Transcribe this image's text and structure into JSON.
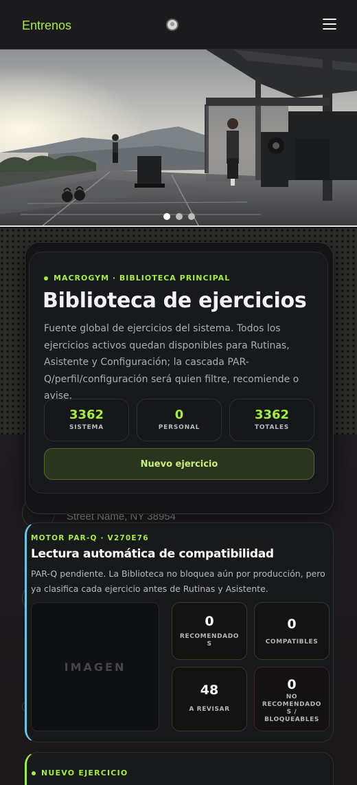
{
  "header": {
    "brand": "Entrenos",
    "avatar_icon": "user-avatar-icon",
    "menu_icon": "hamburger-menu-icon"
  },
  "hero": {
    "image_description_icon": "rooftop-gym-photo",
    "carousel_count": 3,
    "active_slide": 1
  },
  "library": {
    "eyebrow": "MACROGYM · BIBLIOTECA PRINCIPAL",
    "title": "Biblioteca de ejercicios",
    "description": "Fuente global de ejercicios del sistema. Todos los ejercicios activos quedan disponibles para Rutinas, Asistente y Configuración; la cascada PAR-Q/perfil/configuración será quien filtre, recomiende o avise.",
    "stats": [
      {
        "value": "3362",
        "label": "SISTEMA"
      },
      {
        "value": "0",
        "label": "PERSONAL"
      },
      {
        "value": "3362",
        "label": "TOTALES"
      }
    ],
    "new_button": "Nuevo ejercicio"
  },
  "background": {
    "street_text": "Street Name, NY 38954"
  },
  "parq": {
    "eyebrow": "MOTOR PAR-Q · V270E76",
    "title": "Lectura automática de compatibilidad",
    "description": "PAR-Q pendiente. La Biblioteca no bloquea aún por producción, pero ya clasifica cada ejercicio antes de Rutinas y Asistente.",
    "image_placeholder": "IMAGEN",
    "metrics": [
      {
        "value": "0",
        "label": "RECOMENDADO S"
      },
      {
        "value": "0",
        "label": "COMPATIBLES"
      },
      {
        "value": "48",
        "label": "A REVISAR"
      },
      {
        "value": "0",
        "label": "NO RECOMENDADO S / BLOQUEABLES"
      }
    ]
  },
  "next_card": {
    "eyebrow": "NUEVO EJERCICIO"
  },
  "colors": {
    "accent": "#a6ee3c",
    "parq_border": "#6cc4e8",
    "background": "#141416"
  }
}
